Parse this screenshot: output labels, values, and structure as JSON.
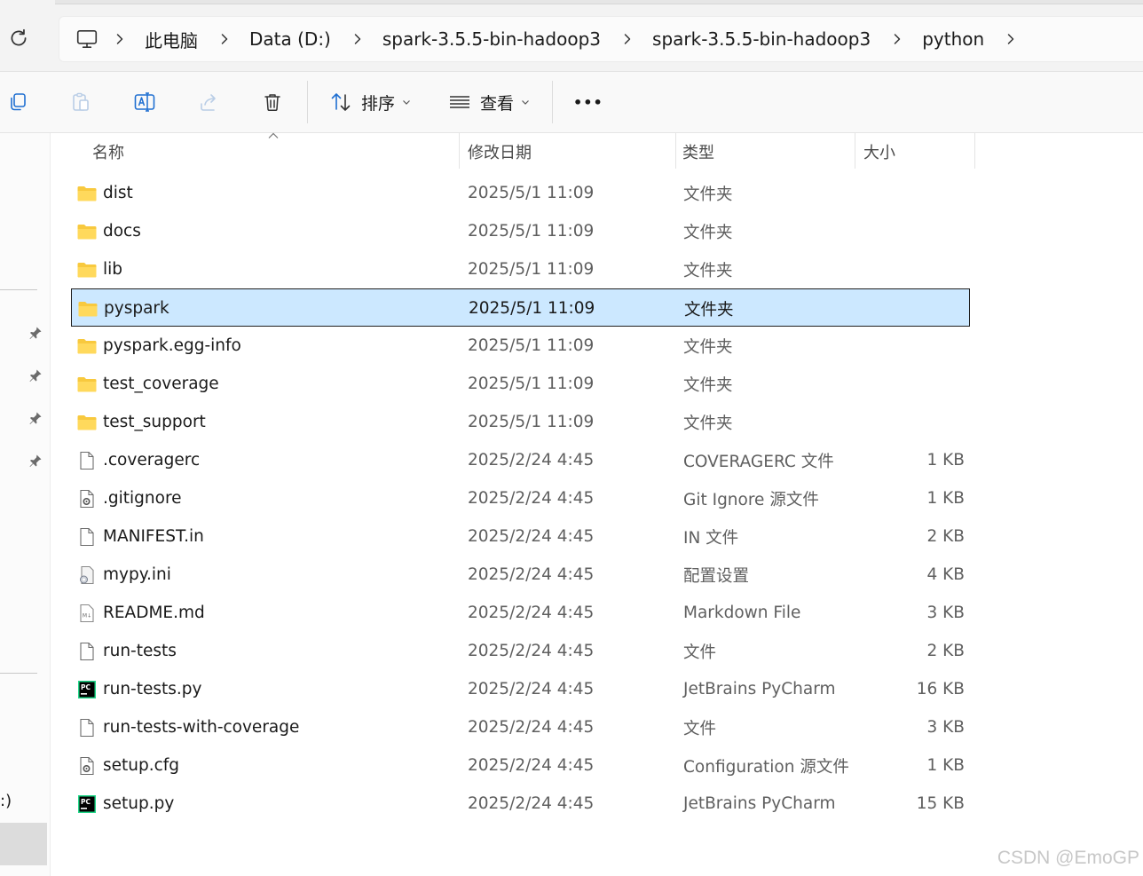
{
  "address": {
    "breadcrumbs": [
      "此电脑",
      "Data (D:)",
      "spark-3.5.5-bin-hadoop3",
      "spark-3.5.5-bin-hadoop3",
      "python"
    ]
  },
  "toolbar": {
    "sort_label": "排序",
    "view_label": "查看",
    "more_label": "•••"
  },
  "columns": {
    "name": "名称",
    "date": "修改日期",
    "type": "类型",
    "size": "大小"
  },
  "files": [
    {
      "name": "dist",
      "date": "2025/5/1 11:09",
      "type": "文件夹",
      "size": "",
      "icon": "folder-icon"
    },
    {
      "name": "docs",
      "date": "2025/5/1 11:09",
      "type": "文件夹",
      "size": "",
      "icon": "folder-icon"
    },
    {
      "name": "lib",
      "date": "2025/5/1 11:09",
      "type": "文件夹",
      "size": "",
      "icon": "folder-icon"
    },
    {
      "name": "pyspark",
      "date": "2025/5/1 11:09",
      "type": "文件夹",
      "size": "",
      "icon": "folder-icon",
      "selected": true
    },
    {
      "name": "pyspark.egg-info",
      "date": "2025/5/1 11:09",
      "type": "文件夹",
      "size": "",
      "icon": "folder-icon"
    },
    {
      "name": "test_coverage",
      "date": "2025/5/1 11:09",
      "type": "文件夹",
      "size": "",
      "icon": "folder-icon"
    },
    {
      "name": "test_support",
      "date": "2025/5/1 11:09",
      "type": "文件夹",
      "size": "",
      "icon": "folder-icon"
    },
    {
      "name": ".coveragerc",
      "date": "2025/2/24 4:45",
      "type": "COVERAGERC 文件",
      "size": "1 KB",
      "icon": "file-icon"
    },
    {
      "name": ".gitignore",
      "date": "2025/2/24 4:45",
      "type": "Git Ignore 源文件",
      "size": "1 KB",
      "icon": "config-file-icon"
    },
    {
      "name": "MANIFEST.in",
      "date": "2025/2/24 4:45",
      "type": "IN 文件",
      "size": "2 KB",
      "icon": "file-icon"
    },
    {
      "name": "mypy.ini",
      "date": "2025/2/24 4:45",
      "type": "配置设置",
      "size": "4 KB",
      "icon": "settings-file-icon"
    },
    {
      "name": "README.md",
      "date": "2025/2/24 4:45",
      "type": "Markdown File",
      "size": "3 KB",
      "icon": "markdown-file-icon"
    },
    {
      "name": "run-tests",
      "date": "2025/2/24 4:45",
      "type": "文件",
      "size": "2 KB",
      "icon": "file-icon"
    },
    {
      "name": "run-tests.py",
      "date": "2025/2/24 4:45",
      "type": "JetBrains PyCharm",
      "size": "16 KB",
      "icon": "pycharm-icon"
    },
    {
      "name": "run-tests-with-coverage",
      "date": "2025/2/24 4:45",
      "type": "文件",
      "size": "3 KB",
      "icon": "file-icon"
    },
    {
      "name": "setup.cfg",
      "date": "2025/2/24 4:45",
      "type": "Configuration 源文件",
      "size": "1 KB",
      "icon": "config-file-icon"
    },
    {
      "name": "setup.py",
      "date": "2025/2/24 4:45",
      "type": "JetBrains PyCharm",
      "size": "15 KB",
      "icon": "pycharm-icon"
    }
  ],
  "nav": {
    "fragment": ":)"
  },
  "watermark": "CSDN @EmoGP",
  "colors": {
    "selection_bg": "#cce8ff",
    "folder_yellow": "#f8c93e",
    "pycharm_green": "#21d789"
  }
}
